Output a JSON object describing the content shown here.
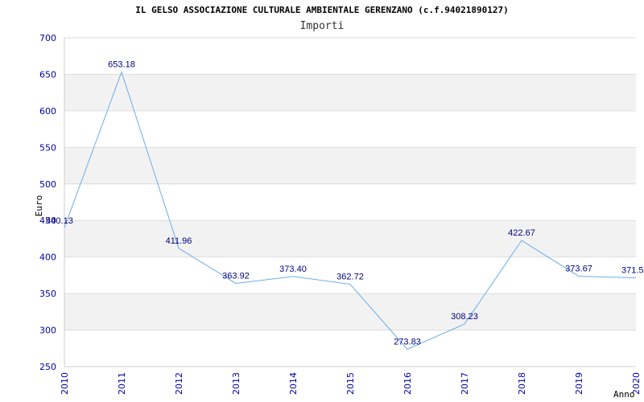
{
  "chart_data": {
    "type": "line",
    "title": "IL GELSO ASSOCIAZIONE CULTURALE AMBIENTALE GERENZANO (c.f.94021890127)",
    "subtitle": "Importi",
    "xlabel": "Anno",
    "ylabel": "Euro",
    "x": [
      "2010",
      "2011",
      "2012",
      "2013",
      "2014",
      "2015",
      "2016",
      "2017",
      "2018",
      "2019",
      "2020"
    ],
    "values": [
      440.13,
      653.18,
      411.96,
      363.92,
      373.4,
      362.72,
      273.83,
      308.23,
      422.67,
      373.67,
      371.5
    ],
    "labels": [
      "440.13",
      "653.18",
      "411.96",
      "363.92",
      "373.40",
      "362.72",
      "273.83",
      "308.23",
      "422.67",
      "373.67",
      "371.5"
    ],
    "ylim": [
      250,
      700
    ],
    "yticks": [
      "250",
      "300",
      "350",
      "400",
      "450",
      "500",
      "550",
      "600",
      "650",
      "700"
    ],
    "line_color": "#6aaee8",
    "band_color": "#f2f2f2",
    "grid": true
  }
}
